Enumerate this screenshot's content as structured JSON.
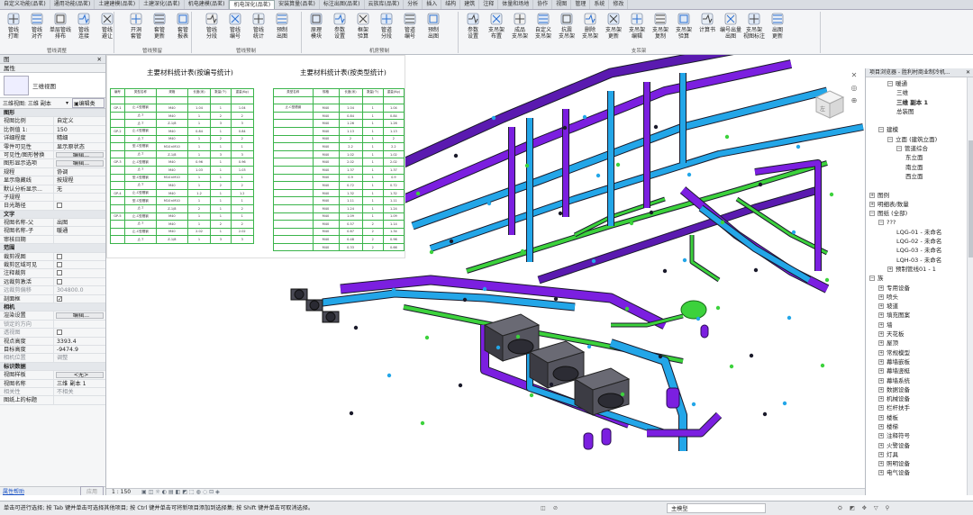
{
  "tabs": [
    "自定义功能(品茗)",
    "通用功能(品茗)",
    "土建建模(品茗)",
    "土建深化(品茗)",
    "机电建模(品茗)",
    "机电深化(品茗)",
    "安装算量(品茗)",
    "标注出图(品茗)",
    "云族库(品茗)",
    "分析",
    "插入",
    "结构",
    "建筑",
    "注释",
    "体量和场地",
    "协作",
    "视图",
    "管理",
    "系统",
    "修改"
  ],
  "active_tab_index": 5,
  "ribbon": {
    "buttons": [
      "管线\n打断",
      "管线\n对齐",
      "单层管线\n排布",
      "管线\n连接",
      "管线\n避让",
      "开洞\n套管",
      "套管\n更新",
      "套管\n报表",
      "管线\n分段",
      "管线\n编号",
      "管线\n统计",
      "预制\n出图",
      "原理\n模块",
      "参数\n设置",
      "框架\n验算",
      "管道\n分段",
      "管道\n编号",
      "预制\n出图",
      "参数\n设置",
      "支吊架\n布置",
      "成品\n支吊架",
      "自定义\n支吊架",
      "抗震\n支吊架",
      "删除\n支吊架",
      "支吊架\n更新",
      "支吊架\n编辑",
      "支吊架\n复制",
      "支吊架\n验算",
      "计算书",
      "编号出量\n出图",
      "支吊架\n视图标注",
      "出图\n更新"
    ],
    "panels": [
      "管线调整",
      "管线预留",
      "管线预制",
      "机房预制",
      "支吊架"
    ]
  },
  "properties": {
    "title": "图",
    "section": "属性",
    "type_name": "三维视图",
    "view_selector": "三维视图: 三维 副本",
    "edit_type": "编辑类",
    "rows": [
      {
        "k": "图形",
        "group": true
      },
      {
        "k": "视图比例",
        "v": "自定义"
      },
      {
        "k": "比例值 1:",
        "v": "150"
      },
      {
        "k": "详细程度",
        "v": "精细"
      },
      {
        "k": "零件可见性",
        "v": "显示原状态"
      },
      {
        "k": "可见性/图形替换",
        "v": "编辑...",
        "btn": true
      },
      {
        "k": "图形显示选项",
        "v": "编辑...",
        "btn": true
      },
      {
        "k": "规程",
        "v": "协调"
      },
      {
        "k": "显示隐藏线",
        "v": "按规程"
      },
      {
        "k": "默认分析显示...",
        "v": "无"
      },
      {
        "k": "子规程",
        "v": ""
      },
      {
        "k": "日光路径",
        "chk": false
      },
      {
        "k": "文字",
        "group": true
      },
      {
        "k": "视图名称-父",
        "v": "出图"
      },
      {
        "k": "视图名称-子",
        "v": "暖通"
      },
      {
        "k": "审核日期",
        "v": ""
      },
      {
        "k": "范围",
        "group": true
      },
      {
        "k": "裁剪视图",
        "chk": false
      },
      {
        "k": "裁剪区域可见",
        "chk": false
      },
      {
        "k": "注释裁剪",
        "chk": false
      },
      {
        "k": "远裁剪激活",
        "chk": false
      },
      {
        "k": "远裁剪偏移",
        "v": "304800.0",
        "grey": true
      },
      {
        "k": "剖面框",
        "chk": true
      },
      {
        "k": "相机",
        "group": true
      },
      {
        "k": "渲染设置",
        "v": "编辑...",
        "btn": true
      },
      {
        "k": "锁定的方向",
        "v": "",
        "grey": true
      },
      {
        "k": "透视图",
        "chk": false,
        "grey": true
      },
      {
        "k": "视点高度",
        "v": "3393.4"
      },
      {
        "k": "目标高度",
        "v": "-9474.9"
      },
      {
        "k": "相机位置",
        "v": "调整",
        "grey": true
      },
      {
        "k": "标识数据",
        "group": true
      },
      {
        "k": "视图样板",
        "v": "<无>",
        "btn": true
      },
      {
        "k": "视图名称",
        "v": "三维 副本 1"
      },
      {
        "k": "相关性",
        "v": "不相关",
        "grey": true
      },
      {
        "k": "图纸上的标题",
        "v": ""
      }
    ],
    "help_link": "属性帮助",
    "apply": "应用"
  },
  "schedule": {
    "title_left": "主要材料统计表(按编号统计)",
    "title_right": "主要材料统计表(按类型统计)",
    "left_rows": [
      [
        "编号",
        "类型名称",
        "规格",
        "长度(米)",
        "数量(个)",
        "重量(Kg)"
      ],
      [
        "",
        "",
        "",
        "",
        "",
        ""
      ],
      [
        "GP-1",
        "止-C型槽钢",
        "M40",
        "1.04",
        "1",
        "1.04"
      ],
      [
        "",
        "止-T",
        "M40",
        "1",
        "2",
        "2"
      ],
      [
        "",
        "止-T",
        "Z-1/8",
        "1",
        "3",
        "3"
      ],
      [
        "GP-2",
        "止-C型槽钢",
        "M40",
        "0.84",
        "1",
        "0.84"
      ],
      [
        "",
        "止-T",
        "M40",
        "1",
        "2",
        "2"
      ],
      [
        "",
        "型-C型槽钢",
        "M10×M10",
        "1",
        "1",
        "1"
      ],
      [
        "",
        "止-T",
        "Z-1/8",
        "1",
        "3",
        "3"
      ],
      [
        "GP-3",
        "止-C型槽钢",
        "M40",
        "0.96",
        "1",
        "0.96"
      ],
      [
        "",
        "止-T",
        "M40",
        "1.03",
        "1",
        "1.03"
      ],
      [
        "",
        "型-C型槽钢",
        "M10×M10",
        "1",
        "1",
        "1"
      ],
      [
        "",
        "止-T",
        "M40",
        "1",
        "2",
        "2"
      ],
      [
        "GP-4",
        "止-C型槽钢",
        "M40",
        "1.2",
        "1",
        "1.2"
      ],
      [
        "",
        "型-C型槽钢",
        "M10×M10",
        "1",
        "1",
        "1"
      ],
      [
        "",
        "止-T",
        "Z-1/8",
        "2",
        "1",
        "2"
      ],
      [
        "GP-5",
        "止-C型槽钢",
        "M40",
        "1",
        "1",
        "1"
      ],
      [
        "",
        "止-T",
        "M40",
        "1",
        "2",
        "2"
      ],
      [
        "",
        "止-C型槽钢",
        "M40",
        "2.02",
        "1",
        "2.02"
      ],
      [
        "",
        "止-T",
        "Z-1/8",
        "1",
        "3",
        "3"
      ]
    ],
    "right_rows": [
      [
        "类型名称",
        "规格",
        "长度(米)",
        "数量(个)",
        "重量(Kg)"
      ],
      [
        "",
        "",
        "",
        "",
        ""
      ],
      [
        "止-C型槽钢",
        "M40",
        "1.04",
        "1",
        "1.04"
      ],
      [
        "",
        "M40",
        "0.84",
        "1",
        "0.84"
      ],
      [
        "",
        "M40",
        "1.26",
        "1",
        "1.26"
      ],
      [
        "",
        "M40",
        "1.13",
        "1",
        "1.13"
      ],
      [
        "",
        "M40",
        "2",
        "1",
        "2"
      ],
      [
        "",
        "M40",
        "2.2",
        "1",
        "2.2"
      ],
      [
        "",
        "M40",
        "1.02",
        "1",
        "1.02"
      ],
      [
        "",
        "M40",
        "2.02",
        "1",
        "2.02"
      ],
      [
        "",
        "M40",
        "1.37",
        "1",
        "1.37"
      ],
      [
        "",
        "M40",
        "0.9",
        "1",
        "0.9"
      ],
      [
        "",
        "M40",
        "0.72",
        "1",
        "0.72"
      ],
      [
        "",
        "M40",
        "1.32",
        "1",
        "1.32"
      ],
      [
        "",
        "M40",
        "1.11",
        "1",
        "1.11"
      ],
      [
        "",
        "M40",
        "1.24",
        "1",
        "1.24"
      ],
      [
        "",
        "M40",
        "1.09",
        "1",
        "1.09"
      ],
      [
        "",
        "M40",
        "0.57",
        "2",
        "1.14"
      ],
      [
        "",
        "M40",
        "0.67",
        "2",
        "1.34"
      ],
      [
        "",
        "M40",
        "0.48",
        "2",
        "0.96"
      ],
      [
        "",
        "M40",
        "0.33",
        "2",
        "0.66"
      ]
    ]
  },
  "viewcube_label": "左",
  "viewbar": {
    "scale": "1 : 150"
  },
  "browser": {
    "title": "项目浏览器 - 胜利村商业制冷机...",
    "nodes": [
      {
        "t": "暖通",
        "lv": 2,
        "tg": "-"
      },
      {
        "t": "三维",
        "lv": 3
      },
      {
        "t": "三维 副本 1",
        "lv": 3,
        "bold": true
      },
      {
        "t": "总装图",
        "lv": 3
      },
      {
        "t": "",
        "lv": 0
      },
      {
        "t": "建模",
        "lv": 1,
        "tg": "-"
      },
      {
        "t": "立面 (建筑立面)",
        "lv": 2,
        "tg": "-"
      },
      {
        "t": "管道综合",
        "lv": 3,
        "tg": "-"
      },
      {
        "t": "东立面",
        "lv": 4
      },
      {
        "t": "南立面",
        "lv": 4
      },
      {
        "t": "西立面",
        "lv": 4
      },
      {
        "t": "",
        "lv": 0
      },
      {
        "t": "图例",
        "lv": 0,
        "tg": "+"
      },
      {
        "t": "明细表/数量",
        "lv": 0,
        "tg": "+"
      },
      {
        "t": "图纸 (全部)",
        "lv": 0,
        "tg": "-"
      },
      {
        "t": "???",
        "lv": 1,
        "tg": "-"
      },
      {
        "t": "LQG-01 - 未命名",
        "lv": 3
      },
      {
        "t": "LQG-02 - 未命名",
        "lv": 3
      },
      {
        "t": "LQG-03 - 未命名",
        "lv": 3
      },
      {
        "t": "LQH-03 - 未命名",
        "lv": 3
      },
      {
        "t": "预制管线01 - 1",
        "lv": 2,
        "tg": "+"
      },
      {
        "t": "族",
        "lv": 0,
        "tg": "-"
      },
      {
        "t": "专用设备",
        "lv": 1,
        "tg": "+"
      },
      {
        "t": "喷头",
        "lv": 1,
        "tg": "+"
      },
      {
        "t": "坡道",
        "lv": 1,
        "tg": "+"
      },
      {
        "t": "填充图案",
        "lv": 1,
        "tg": "+"
      },
      {
        "t": "墙",
        "lv": 1,
        "tg": "+"
      },
      {
        "t": "天花板",
        "lv": 1,
        "tg": "+"
      },
      {
        "t": "屋顶",
        "lv": 1,
        "tg": "+"
      },
      {
        "t": "常规模型",
        "lv": 1,
        "tg": "+"
      },
      {
        "t": "幕墙嵌板",
        "lv": 1,
        "tg": "+"
      },
      {
        "t": "幕墙竖梃",
        "lv": 1,
        "tg": "+"
      },
      {
        "t": "幕墙系统",
        "lv": 1,
        "tg": "+"
      },
      {
        "t": "数据设备",
        "lv": 1,
        "tg": "+"
      },
      {
        "t": "机械设备",
        "lv": 1,
        "tg": "+"
      },
      {
        "t": "栏杆扶手",
        "lv": 1,
        "tg": "+"
      },
      {
        "t": "楼板",
        "lv": 1,
        "tg": "+"
      },
      {
        "t": "楼梯",
        "lv": 1,
        "tg": "+"
      },
      {
        "t": "注释符号",
        "lv": 1,
        "tg": "+"
      },
      {
        "t": "火警设备",
        "lv": 1,
        "tg": "+"
      },
      {
        "t": "灯具",
        "lv": 1,
        "tg": "+"
      },
      {
        "t": "照明设备",
        "lv": 1,
        "tg": "+"
      },
      {
        "t": "电气设备",
        "lv": 1,
        "tg": "+"
      }
    ]
  },
  "status": {
    "text": "单击可进行选择; 按 Tab 键并单击可选择其他项目; 按 Ctrl 键并单击可将新项目添加到选择集; 按 Shift 键并单击可取消选择。",
    "model": "主模型"
  },
  "colors": {
    "purple": "#7b1fe0",
    "blue": "#23a6e8",
    "green": "#3cd23c",
    "dark": "#3c3c44",
    "grid": "#3ab44a"
  }
}
